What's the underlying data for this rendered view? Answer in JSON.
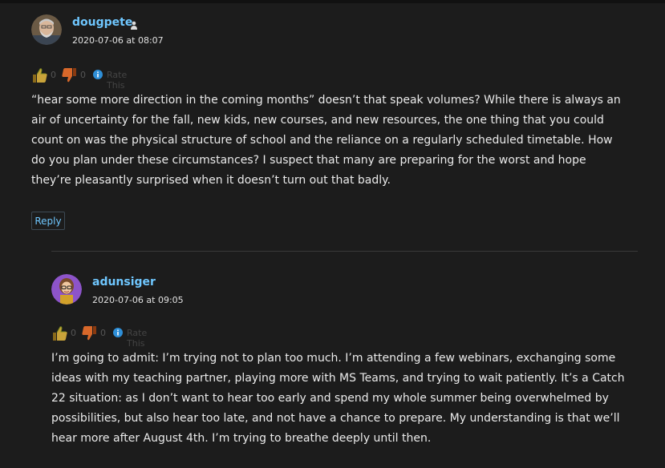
{
  "comments": [
    {
      "author": "dougpete",
      "date": "2020-07-06 at 08:07",
      "rating": {
        "up_count": "0",
        "down_count": "0",
        "rate_label": "Rate This"
      },
      "body": "“hear some more direction in the coming months” doesn’t that speak volumes? While there is always an air of uncertainty for the fall, new kids, new courses, and new resources, the one thing that you could count on was the physical structure of school and the reliance on a regularly scheduled timetable. How do you plan under these circumstances? I suspect that many are preparing for the worst and hope they’re pleasantly surprised when it doesn’t turn out that badly.",
      "reply_label": "Reply"
    },
    {
      "author": "adunsiger",
      "date": "2020-07-06 at 09:05",
      "rating": {
        "up_count": "0",
        "down_count": "0",
        "rate_label": "Rate This"
      },
      "body": "I’m going to admit: I’m trying not to plan too much. I’m attending a few webinars, exchanging some ideas with my teaching partner, playing more with MS Teams, and trying to wait patiently. It’s a Catch 22 situation: as I don’t want to hear too early and spend my whole summer being overwhelmed by possibilities, but also hear too late, and not have a chance to prepare. My understanding is that we’ll hear more after August 4th. I’m trying to breathe deeply until then."
    }
  ],
  "colors": {
    "background": "#1c1c1c",
    "author_link": "#6fc7ff",
    "body_text": "#eaeaea",
    "divider": "#3a3a3a"
  },
  "icons": [
    "thumbs-up-icon",
    "thumbs-down-icon",
    "info-icon",
    "user-icon"
  ]
}
